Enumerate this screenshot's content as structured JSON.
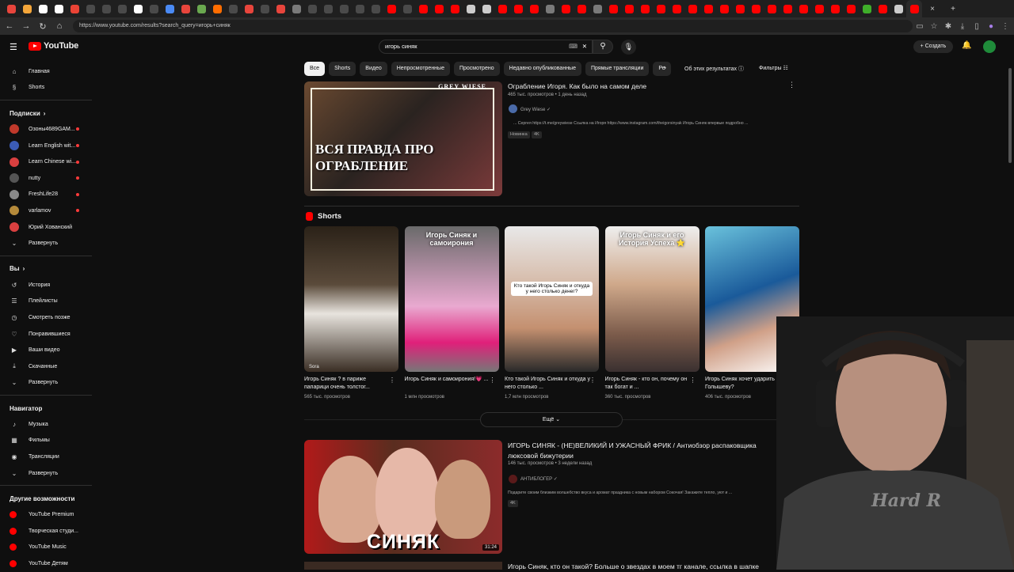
{
  "browser": {
    "url": "https://www.youtube.com/results?search_query=игорь+синяк",
    "tab_colors": [
      "#e8453c",
      "#f4a63a",
      "#ffffff",
      "#ffffff",
      "#ea4335",
      "#4a4a4a",
      "#4a4a4a",
      "#4a4a4a",
      "#ffffff",
      "#4a4a4a",
      "#4a8af4",
      "#e8453c",
      "#6aa84f",
      "#ff6d00",
      "#4a4a4a",
      "#e8453c",
      "#4a4a4a",
      "#e8453c",
      "#7a7a7a",
      "#4a4a4a",
      "#4a4a4a",
      "#4a4a4a",
      "#4a4a4a",
      "#4a4a4a",
      "#ff0000",
      "#4a4a4a",
      "#ff0000",
      "#ff0000",
      "#ff0000",
      "#cccccc",
      "#cccccc",
      "#ff0000",
      "#ff0000",
      "#ff0000",
      "#7a7a7a",
      "#ff0000",
      "#ff0000",
      "#7a7a7a",
      "#ff0000",
      "#ff0000",
      "#ff0000",
      "#ff0000",
      "#ff0000",
      "#ff0000",
      "#ff0000",
      "#ff0000",
      "#ff0000",
      "#ff0000",
      "#ff0000",
      "#ff0000",
      "#ff0000",
      "#ff0000",
      "#ff0000",
      "#ff0000",
      "#3fae2a",
      "#ff0000",
      "#cccccc",
      "#ff0000"
    ],
    "new_tab": "+",
    "close_tab": "×"
  },
  "youtube": {
    "logo_text": "YouTube",
    "search_value": "игорь синяк",
    "create_label": "Создать",
    "sidebar": {
      "main": [
        {
          "label": "Главная",
          "icon": "⌂"
        },
        {
          "label": "Shorts",
          "icon": "§"
        }
      ],
      "subs_header": "Подписки",
      "subs": [
        {
          "label": "Озоны4689GAM...",
          "color": "#c0392b"
        },
        {
          "label": "Learn English wit...",
          "color": "#3b5bb5"
        },
        {
          "label": "Learn Chinese wi...",
          "color": "#d94040"
        },
        {
          "label": "nutty",
          "color": "#555555"
        },
        {
          "label": "FreshLife28",
          "color": "#8a8a8a"
        },
        {
          "label": "varlamov",
          "color": "#b58a3a"
        },
        {
          "label": "Юрий Хованский",
          "color": "#d94040"
        }
      ],
      "subs_expand": "Развернуть",
      "you_header": "Вы",
      "you": [
        {
          "label": "История",
          "icon": "↺"
        },
        {
          "label": "Плейлисты",
          "icon": "☰"
        },
        {
          "label": "Смотреть позже",
          "icon": "◷"
        },
        {
          "label": "Понравившиеся",
          "icon": "♡"
        },
        {
          "label": "Ваши видео",
          "icon": "▶"
        },
        {
          "label": "Скачанные",
          "icon": "⤓"
        },
        {
          "label": "Развернуть",
          "icon": "⌄"
        }
      ],
      "nav_header": "Навигатор",
      "nav": [
        {
          "label": "Музыка",
          "icon": "♪"
        },
        {
          "label": "Фильмы",
          "icon": "▦"
        },
        {
          "label": "Трансляции",
          "icon": "◉"
        },
        {
          "label": "Развернуть",
          "icon": "⌄"
        }
      ],
      "more_header": "Другие возможности",
      "more": [
        {
          "label": "YouTube Premium"
        },
        {
          "label": "Творческая студи..."
        },
        {
          "label": "YouTube Music"
        },
        {
          "label": "YouTube Детям"
        }
      ]
    },
    "chips": [
      "Все",
      "Shorts",
      "Видео",
      "Непросмотренные",
      "Просмотрено",
      "Недавно опубликованные",
      "Прямые трансляции",
      "Ре"
    ],
    "about_results": "Об этих результатах",
    "filters_label": "Фильтры",
    "video1": {
      "title": "Ограбление Игоря. Как было на самом деле",
      "meta": "465 тыс. просмотров • 1 день назад",
      "channel": "Grey Wiese",
      "desc": "... Сергея https://t.me/greywiese Ссылка на Игоря https://www.instagram.com/theigorsinyak Игорь Синяк впервые подробно ...",
      "badge1": "Новинка",
      "badge2": "4K",
      "thumb_text": "ВСЯ ПРАВДА ПРО ОГРАБЛЕНИЕ",
      "thumb_brand": "GREY WIESE"
    },
    "shorts_header": "Shorts",
    "shorts": [
      {
        "title": "Игорь Синяк ? в париже папарици очень толстог...",
        "views": "565 тыс. просмотров",
        "cap": "",
        "pill": "",
        "bg": "linear-gradient(180deg,#2b2218,#5a4a3a 40%,#e8e4de 60%,#3a2e24)",
        "wm": "Sora"
      },
      {
        "title": "Игорь Синяк и самоирония!💗 ...",
        "views": "1 млн просмотров",
        "cap": "Игорь Синяк и самоирония",
        "pill": "",
        "bg": "linear-gradient(180deg,#6a6a6a,#e9a9d0 55%,#e0207a 80%,#777)",
        "wm": ""
      },
      {
        "title": "Кто такой Игорь Синяк и откуда у него столько ...",
        "views": "1,7 млн просмотров",
        "cap": "",
        "pill": "Кто такой Игорь Синяк и откуда у него столько денег?",
        "bg": "linear-gradient(180deg,#e8e8e8,#d8c0b0 35%,#c49070 70%,#2a2a2a)",
        "wm": ""
      },
      {
        "title": "Игорь Синяк - кто он, почему он так богат и ...",
        "views": "360 тыс. просмотров",
        "cap": "Игорь Синяк и его История Успеха ⭐",
        "pill": "",
        "bg": "linear-gradient(180deg,#eeeeee,#cfa88a 40%,#7a5a4a 75%,#3a3030)",
        "wm": ""
      },
      {
        "title": "Игорь Синяк хочет ударить Катю Голышеву?",
        "views": "406 тыс. просмотров",
        "cap": "",
        "pill": "",
        "bg": "linear-gradient(160deg,#6ac2dc,#1a5a9a 45%,#d0a088 70%,#fff)",
        "wm": ""
      }
    ],
    "more_button": "Ещё",
    "video2": {
      "title": "ИГОРЬ СИНЯК - (НЕ)ВЕЛИКИЙ И УЖАСНЫЙ ФРИК / Антиобзор распаковщика люксовой бижутерии",
      "meta": "146 тыс. просмотров • 3 недели назад",
      "channel": "АНТИБЛОГЕР",
      "desc": "Подарите своим близким волшебство вкуса и аромат праздника с новым набором Сокочая! Закажите тепло, уют и ...",
      "badge": "4K",
      "thumb_text": "СИНЯК",
      "duration": "31:24"
    },
    "video3": {
      "title": "Игорь Синяк, кто он такой? Больше о звездах в моем тг канале, ссылка в шапке"
    },
    "webcam_text": "Hard R"
  }
}
